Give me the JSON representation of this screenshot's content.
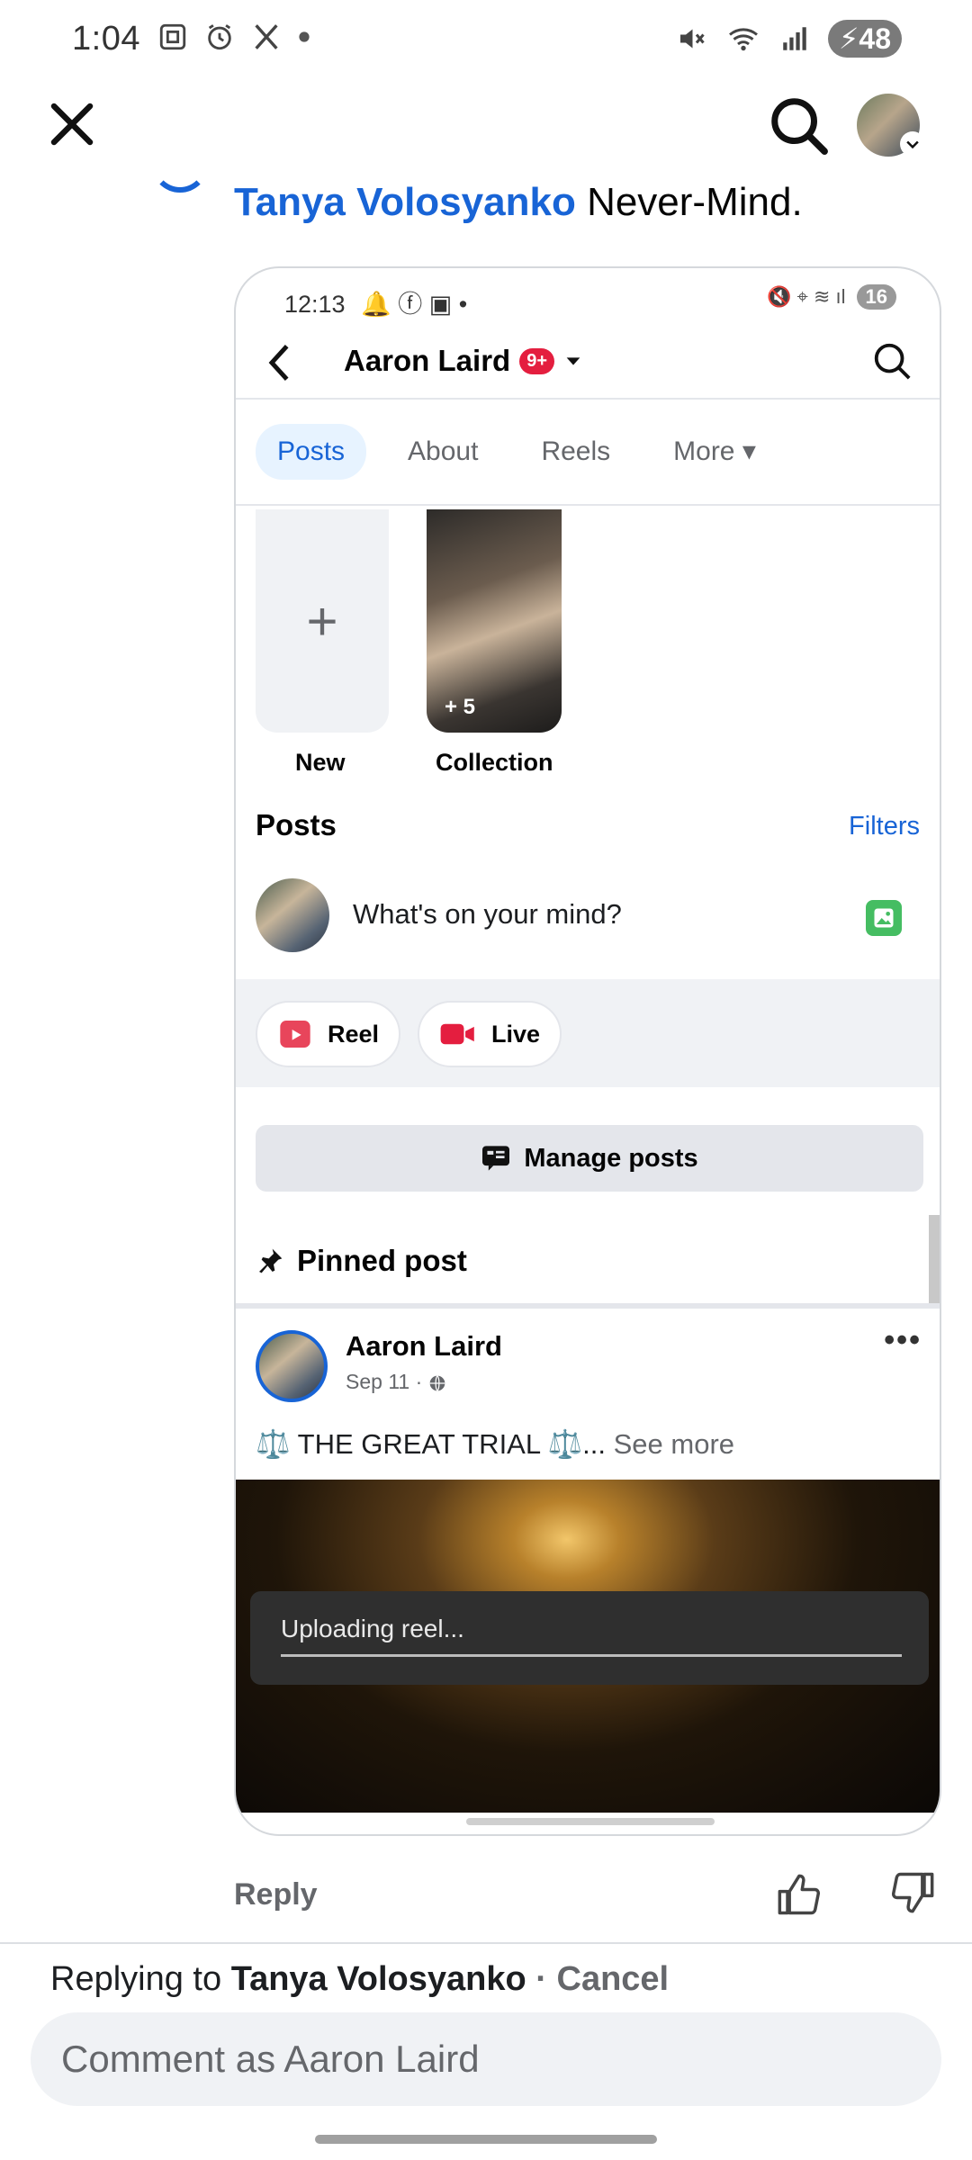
{
  "status_bar": {
    "time": "1:04",
    "battery": "48",
    "left_icons": [
      "screenshot-icon",
      "alarm-icon",
      "x-app-icon",
      "dot-icon"
    ],
    "right_icons": [
      "mute-icon",
      "wifi-icon",
      "signal-icon",
      "battery-icon"
    ]
  },
  "comment": {
    "author": "Tanya Volosyanko",
    "text": "Never-Mind."
  },
  "embedded": {
    "status_time": "12:13",
    "status_battery": "16",
    "profile_name": "Aaron Laird",
    "notification_badge": "9+",
    "tabs": [
      {
        "label": "Posts",
        "active": true
      },
      {
        "label": "About",
        "active": false
      },
      {
        "label": "Reels",
        "active": false
      },
      {
        "label": "More",
        "active": false
      }
    ],
    "tiles": {
      "new_label": "New",
      "collection_label": "Collection",
      "collection_count": "+ 5"
    },
    "posts_heading": "Posts",
    "filters_label": "Filters",
    "composer_placeholder": "What's on your mind?",
    "reel_label": "Reel",
    "live_label": "Live",
    "manage_posts_label": "Manage posts",
    "pinned_label": "Pinned post",
    "post": {
      "author": "Aaron Laird",
      "date": "Sep 11 ·",
      "text": "⚖️ THE GREAT TRIAL ⚖️...",
      "see_more": "See more"
    },
    "upload_status": "Uploading reel..."
  },
  "actions": {
    "reply_label": "Reply"
  },
  "composer": {
    "replying_prefix": "Replying to",
    "replying_to": "Tanya Volosyanko",
    "separator": "·",
    "cancel_label": "Cancel",
    "placeholder": "Comment as Aaron Laird"
  },
  "colors": {
    "accent": "#1864d6",
    "badge": "#e41e3f",
    "reel": "#e8455b",
    "live": "#e41e3f",
    "photo": "#45bd62"
  }
}
